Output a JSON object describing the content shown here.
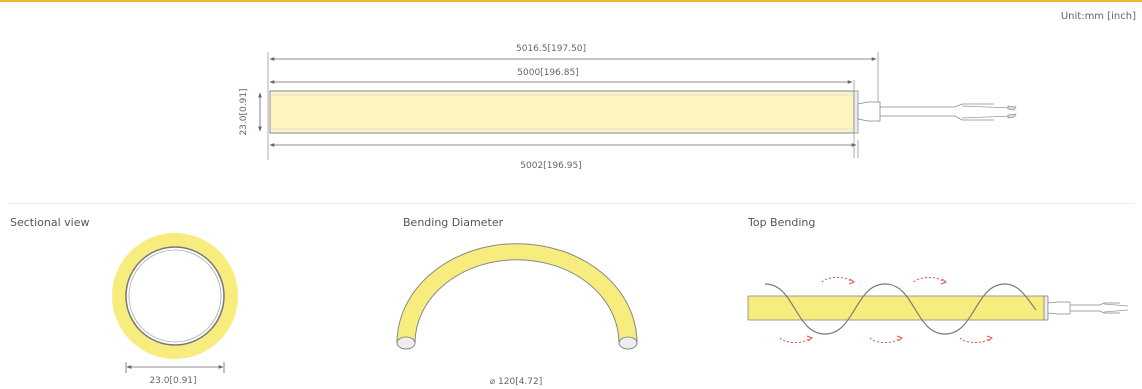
{
  "header": {
    "unit_label": "Unit:mm [inch]"
  },
  "main_drawing": {
    "overall_length": "5016.5[197.50]",
    "body_length": "5000[196.85]",
    "total_with_cap": "5002[196.95]",
    "height": "23.0[0.91]"
  },
  "sectional_view": {
    "title": "Sectional view",
    "dimension": "23.0[0.91]"
  },
  "bending_diameter": {
    "title": "Bending Diameter",
    "dimension": "⌀ 120[4.72]"
  },
  "top_bending": {
    "title": "Top Bending"
  },
  "colors": {
    "accent": "#f4b63a",
    "strip_fill": "#f7ec7e",
    "line": "#888888",
    "red": "#e05050"
  }
}
